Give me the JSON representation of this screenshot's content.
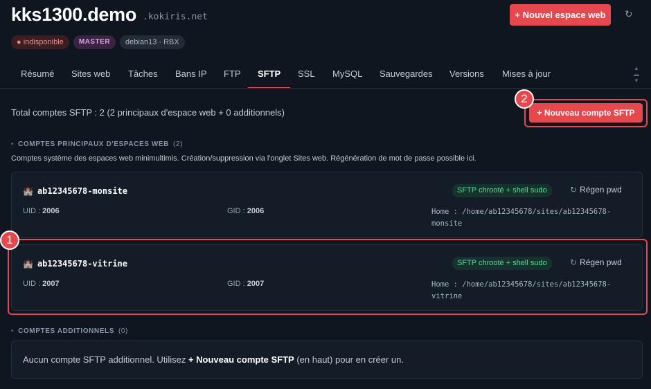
{
  "header": {
    "site_title": "kks1300.demo",
    "domain": ".kokiris.net",
    "new_space_label": "+ Nouvel espace web",
    "refresh_icon": "↻"
  },
  "badges": [
    "● indisponible",
    "MASTER",
    "debian13 · RBX"
  ],
  "tabs": [
    "Résumé",
    "Sites web",
    "Tâches",
    "Bans IP",
    "FTP",
    "SFTP",
    "SSL",
    "MySQL",
    "Sauvegardes",
    "Versions",
    "Mises à jour"
  ],
  "active_tab": "SFTP",
  "total_text": "Total comptes SFTP : 2 (2 principaux d'espace web + 0 additionnels)",
  "new_sftp_label": "+ Nouveau compte SFTP",
  "principal": {
    "heading": "COMPTES PRINCIPAUX D'ESPACES WEB",
    "count": "(2)",
    "description": "Comptes système des espaces web minimultimis. Création/suppression via l'onglet Sites web. Régénération de mot de passe possible ici.",
    "accounts": [
      {
        "name": "ab12345678-monsite",
        "icon": "🏰",
        "shell_badge": "SFTP chrooté + shell sudo",
        "regen_label": "Régen pwd",
        "uid_label": "UID :",
        "uid": "2006",
        "gid_label": "GID :",
        "gid": "2006",
        "home_line1": "Home : /home/ab12345678/sites/ab12345678-",
        "home_line2": "monsite"
      },
      {
        "name": "ab12345678-vitrine",
        "icon": "🏰",
        "shell_badge": "SFTP chrooté + shell sudo",
        "regen_label": "Régen pwd",
        "uid_label": "UID :",
        "uid": "2007",
        "gid_label": "GID :",
        "gid": "2007",
        "home_line1": "Home : /home/ab12345678/sites/ab12345678-",
        "home_line2": "vitrine"
      }
    ]
  },
  "additional": {
    "heading": "COMPTES ADDITIONNELS",
    "count": "(0)",
    "empty_pre": "Aucun compte SFTP additionnel. Utilisez ",
    "empty_bold": "+ Nouveau compte SFTP",
    "empty_post": " (en haut) pour en créer un."
  },
  "annotations": [
    "1",
    "2"
  ],
  "colors": {
    "accent": "#e5484d",
    "background": "#0f1620",
    "card": "#141c27",
    "success": "#5fd6a4"
  }
}
